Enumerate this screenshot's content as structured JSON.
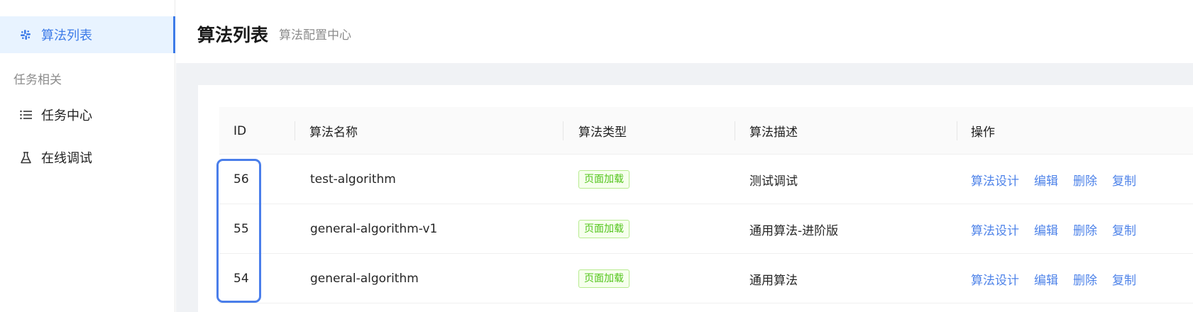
{
  "sidebar": {
    "items": [
      {
        "label": "算法列表",
        "icon": "slack-icon",
        "active": true
      },
      {
        "label": "任务中心",
        "icon": "list-icon",
        "active": false
      },
      {
        "label": "在线调试",
        "icon": "flask-icon",
        "active": false
      }
    ],
    "group_title": "任务相关"
  },
  "header": {
    "title": "算法列表",
    "subtitle": "算法配置中心"
  },
  "table": {
    "columns": [
      "ID",
      "算法名称",
      "算法类型",
      "算法描述",
      "操作"
    ],
    "rows": [
      {
        "id": "56",
        "name": "test-algorithm",
        "type": "页面加载",
        "description": "测试调试",
        "actions": [
          "算法设计",
          "编辑",
          "删除",
          "复制"
        ]
      },
      {
        "id": "55",
        "name": "general-algorithm-v1",
        "type": "页面加载",
        "description": "通用算法-进阶版",
        "actions": [
          "算法设计",
          "编辑",
          "删除",
          "复制"
        ]
      },
      {
        "id": "54",
        "name": "general-algorithm",
        "type": "页面加载",
        "description": "通用算法",
        "actions": [
          "算法设计",
          "编辑",
          "删除",
          "复制"
        ]
      }
    ]
  },
  "colors": {
    "accent": "#3d7be8",
    "link": "#4e83e9",
    "tag_green": "#52c41a",
    "highlight": "#4a7eea"
  }
}
